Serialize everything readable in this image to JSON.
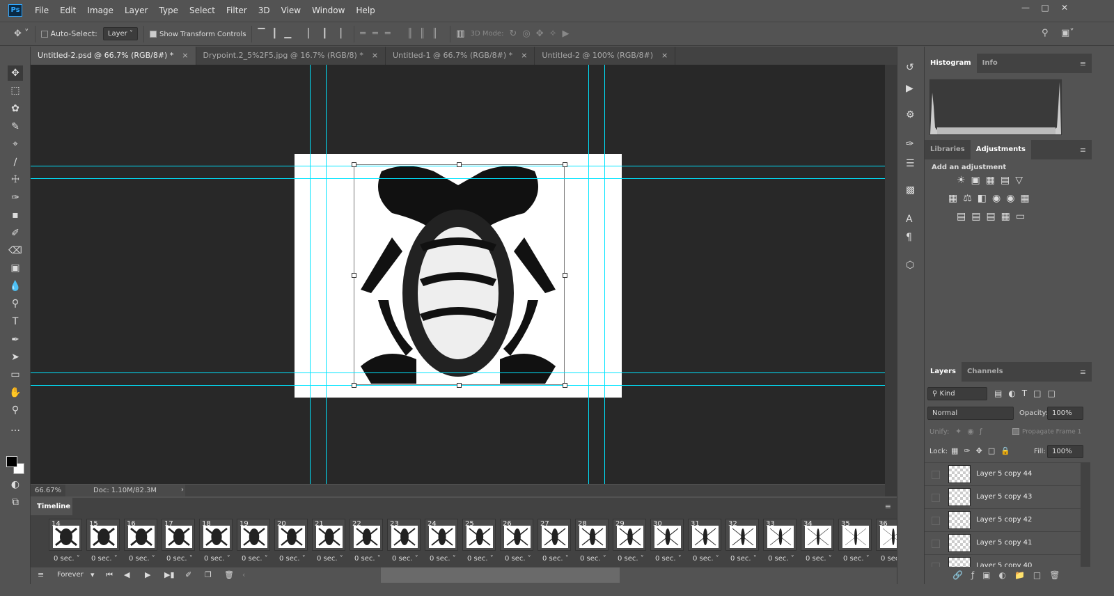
{
  "app": {
    "logo": "Ps",
    "menu": [
      "File",
      "Edit",
      "Image",
      "Layer",
      "Type",
      "Select",
      "Filter",
      "3D",
      "View",
      "Window",
      "Help"
    ]
  },
  "options": {
    "auto_select_label": "Auto-Select:",
    "auto_select_checked": false,
    "layer_select": "Layer",
    "show_transform_label": "Show Transform Controls",
    "show_transform_checked": true,
    "mode_3d_label": "3D Mode:"
  },
  "tabs": [
    {
      "label": "Untitled-2.psd @ 66.7% (RGB/8#) *",
      "active": true
    },
    {
      "label": "Drypoint.2_5%2F5.jpg @ 16.7% (RGB/8) *",
      "active": false
    },
    {
      "label": "Untitled-1 @ 66.7% (RGB/8#) *",
      "active": false
    },
    {
      "label": "Untitled-2 @ 100% (RGB/8#)",
      "active": false
    }
  ],
  "status": {
    "zoom": "66.67%",
    "doc": "Doc: 1.10M/82.3M"
  },
  "timeline": {
    "title": "Timeline",
    "loop": "Forever",
    "frames": [
      {
        "n": "14",
        "d": "0 sec."
      },
      {
        "n": "15",
        "d": "0 sec."
      },
      {
        "n": "16",
        "d": "0 sec."
      },
      {
        "n": "17",
        "d": "0 sec."
      },
      {
        "n": "18",
        "d": "0 sec."
      },
      {
        "n": "19",
        "d": "0 sec."
      },
      {
        "n": "20",
        "d": "0 sec."
      },
      {
        "n": "21",
        "d": "0 sec."
      },
      {
        "n": "22",
        "d": "0 sec."
      },
      {
        "n": "23",
        "d": "0 sec."
      },
      {
        "n": "24",
        "d": "0 sec."
      },
      {
        "n": "25",
        "d": "0 sec."
      },
      {
        "n": "26",
        "d": "0 sec."
      },
      {
        "n": "27",
        "d": "0 sec."
      },
      {
        "n": "28",
        "d": "0 sec."
      },
      {
        "n": "29",
        "d": "0 sec."
      },
      {
        "n": "30",
        "d": "0 sec."
      },
      {
        "n": "31",
        "d": "0 sec."
      },
      {
        "n": "32",
        "d": "0 sec."
      },
      {
        "n": "33",
        "d": "0 sec."
      },
      {
        "n": "34",
        "d": "0 sec."
      },
      {
        "n": "35",
        "d": "0 sec."
      },
      {
        "n": "36",
        "d": "0 sec"
      }
    ]
  },
  "panels": {
    "histogram_tab": "Histogram",
    "info_tab": "Info",
    "libraries_tab": "Libraries",
    "adjustments_tab": "Adjustments",
    "add_adjustment": "Add an adjustment",
    "layers_tab": "Layers",
    "channels_tab": "Channels",
    "kind": "Kind",
    "blend": "Normal",
    "opacity_label": "Opacity:",
    "opacity": "100%",
    "unify_label": "Unify:",
    "propagate": "Propagate Frame 1",
    "lock_label": "Lock:",
    "fill_label": "Fill:",
    "fill": "100%",
    "layers": [
      "Layer 5 copy 44",
      "Layer 5 copy 43",
      "Layer 5 copy 42",
      "Layer 5 copy 41",
      "Layer 5 copy 40"
    ]
  },
  "colors": {
    "guide": "#00e5ff",
    "canvas_bg": "#282828",
    "panel": "#535353"
  }
}
